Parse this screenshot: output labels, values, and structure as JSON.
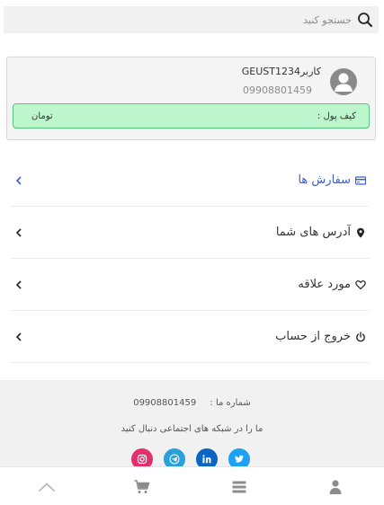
{
  "search": {
    "placeholder": "جستجو کنید",
    "value": ""
  },
  "profile": {
    "name": "کاربرGEUST1234",
    "phone": "09908801459",
    "wallet_label": "کیف پول :",
    "wallet_currency": "تومان"
  },
  "menu": {
    "items": [
      {
        "label": "سفارش ها",
        "icon": "card-icon",
        "active": true
      },
      {
        "label": "آدرس های شما",
        "icon": "location-pin-icon",
        "active": false
      },
      {
        "label": "مورد علاقه",
        "icon": "heart-icon",
        "active": false
      },
      {
        "label": "خروج از حساب",
        "icon": "power-icon",
        "active": false
      }
    ]
  },
  "footer": {
    "phone_label": "شماره ما :",
    "phone_number": "09908801459",
    "follow_text": "ما را در شبکه های اجتماعی دنبال کنید",
    "social": [
      {
        "name": "twitter-icon",
        "color": "#1da1f2"
      },
      {
        "name": "linkedin-icon",
        "color": "#0a66c2"
      },
      {
        "name": "telegram-icon",
        "color": "#2aa1da"
      },
      {
        "name": "instagram-icon",
        "color": "#e1306c"
      }
    ]
  },
  "bottom_nav": {
    "items": [
      "profile-icon",
      "menu-list-icon",
      "cart-icon",
      "scroll-up-icon"
    ]
  },
  "colors": {
    "accent": "#3b5fd0",
    "wallet_bg": "#bdf5cd",
    "wallet_border": "#57c77b",
    "footer_bg": "#f1f1f1"
  }
}
